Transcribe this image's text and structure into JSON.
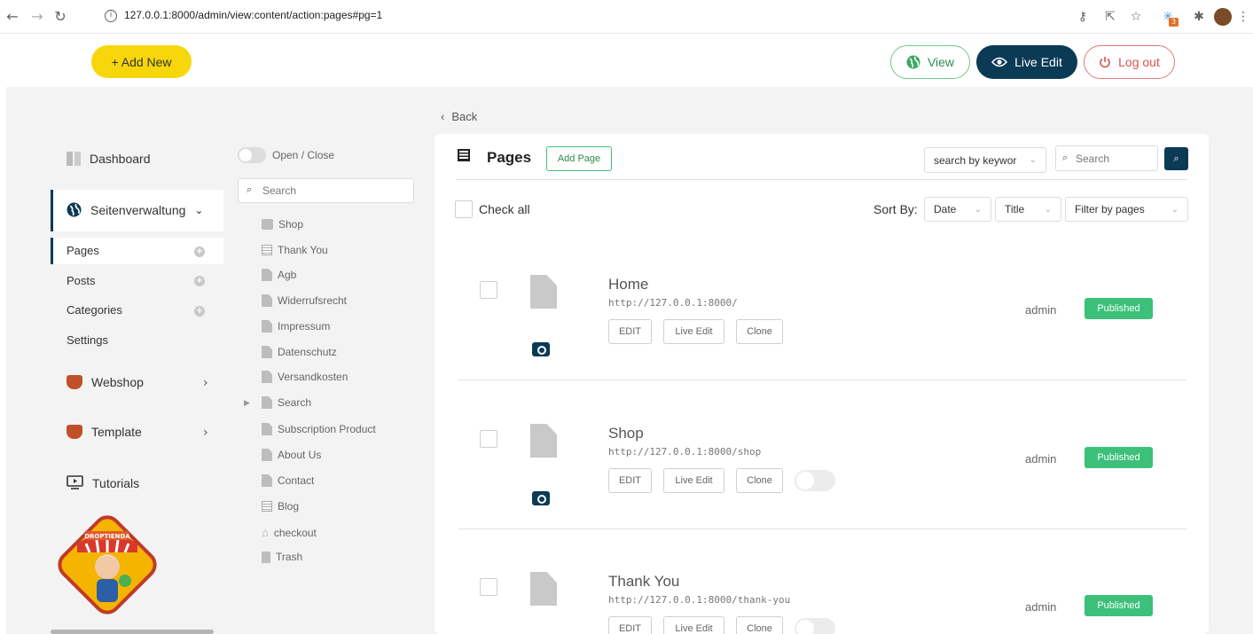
{
  "browser": {
    "url": "127.0.0.1:8000/admin/view:content/action:pages#pg=1",
    "extension_badge": "3"
  },
  "header": {
    "add_new": "+ Add New",
    "view": "View",
    "live_edit": "Live Edit",
    "logout": "Log out"
  },
  "sidebar": {
    "dashboard": "Dashboard",
    "seitenverwaltung": "Seitenverwaltung",
    "pages": "Pages",
    "posts": "Posts",
    "categories": "Categories",
    "settings": "Settings",
    "webshop": "Webshop",
    "template": "Template",
    "tutorials": "Tutorials",
    "logo_text": "DROPTIENDA"
  },
  "tree": {
    "toggle_label": "Open / Close",
    "search_placeholder": "Search",
    "items": [
      {
        "label": "Shop",
        "icon": "bag-icon"
      },
      {
        "label": "Thank You",
        "icon": "list-icon"
      },
      {
        "label": "Agb",
        "icon": "file-icon"
      },
      {
        "label": "Widerrufsrecht",
        "icon": "file-icon"
      },
      {
        "label": "Impressum",
        "icon": "file-icon"
      },
      {
        "label": "Datenschutz",
        "icon": "file-icon"
      },
      {
        "label": "Versandkosten",
        "icon": "file-icon"
      },
      {
        "label": "Search",
        "icon": "file-icon"
      },
      {
        "label": "Subscription Product",
        "icon": "file-icon"
      },
      {
        "label": "About Us",
        "icon": "file-icon"
      },
      {
        "label": "Contact",
        "icon": "file-icon"
      },
      {
        "label": "Blog",
        "icon": "list-icon"
      },
      {
        "label": "checkout",
        "icon": "home-icon"
      },
      {
        "label": "Trash",
        "icon": "trash-icon"
      }
    ]
  },
  "main": {
    "back": "Back",
    "title": "Pages",
    "add_page": "Add Page",
    "search_type": "search by keywor",
    "search_placeholder": "Search",
    "check_all": "Check all",
    "sort_by": "Sort By:",
    "sort_date": "Date",
    "sort_title": "Title",
    "filter": "Filter by pages",
    "rows": [
      {
        "title": "Home",
        "url": "http://127.0.0.1:8000/",
        "author": "admin",
        "status": "Published",
        "edit": "EDIT",
        "live_edit": "Live Edit",
        "clone": "Clone"
      },
      {
        "title": "Shop",
        "url": "http://127.0.0.1:8000/shop",
        "author": "admin",
        "status": "Published",
        "edit": "EDIT",
        "live_edit": "Live Edit",
        "clone": "Clone"
      },
      {
        "title": "Thank You",
        "url": "http://127.0.0.1:8000/thank-you",
        "author": "admin",
        "status": "Published",
        "edit": "EDIT",
        "live_edit": "Live Edit",
        "clone": "Clone"
      }
    ]
  },
  "colors": {
    "accent": "#0b3a55",
    "add_new": "#f7d70b",
    "published": "#3cc07a"
  }
}
